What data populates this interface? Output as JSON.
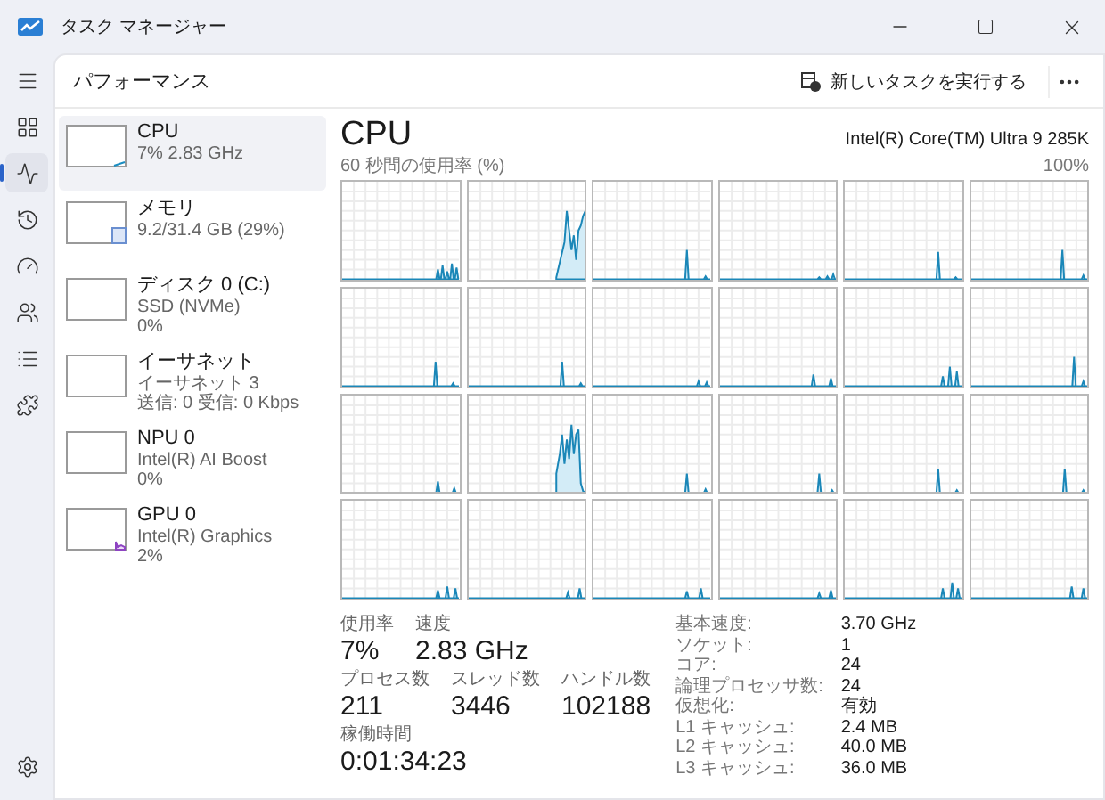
{
  "window": {
    "title": "タスク マネージャー"
  },
  "nav_items": [
    {
      "kind": "menu",
      "selected": false
    },
    {
      "kind": "processes",
      "selected": false
    },
    {
      "kind": "performance",
      "selected": true
    },
    {
      "kind": "history",
      "selected": false
    },
    {
      "kind": "startup",
      "selected": false
    },
    {
      "kind": "users",
      "selected": false
    },
    {
      "kind": "details",
      "selected": false
    },
    {
      "kind": "services",
      "selected": false
    }
  ],
  "header": {
    "title": "パフォーマンス",
    "run_task_button": "新しいタスクを実行する"
  },
  "devices": [
    {
      "kind": "cpu",
      "name": "CPU",
      "lines": [
        "7% 2.83 GHz"
      ],
      "selected": true
    },
    {
      "kind": "memory",
      "name": "メモリ",
      "lines": [
        "9.2/31.4 GB (29%)"
      ],
      "selected": false
    },
    {
      "kind": "disk",
      "name": "ディスク 0 (C:)",
      "lines": [
        "SSD (NVMe)",
        "0%"
      ],
      "selected": false
    },
    {
      "kind": "network",
      "name": "イーサネット",
      "lines": [
        "イーサネット 3",
        "送信: 0 受信: 0 Kbps"
      ],
      "selected": false
    },
    {
      "kind": "npu",
      "name": "NPU 0",
      "lines": [
        "Intel(R) AI Boost",
        "0%"
      ],
      "selected": false
    },
    {
      "kind": "gpu",
      "name": "GPU 0",
      "lines": [
        "Intel(R) Graphics",
        "2%"
      ],
      "selected": false
    }
  ],
  "detail": {
    "title": "CPU",
    "model": "Intel(R) Core(TM) Ultra 9 285K",
    "graph_caption": "60 秒間の使用率 (%)",
    "graph_max": "100%",
    "stats": [
      [
        {
          "label": "使用率",
          "value": "7%"
        },
        {
          "label": "速度",
          "value": "2.83 GHz"
        }
      ],
      [
        {
          "label": "プロセス数",
          "value": "211"
        },
        {
          "label": "スレッド数",
          "value": "3446"
        },
        {
          "label": "ハンドル数",
          "value": "102188"
        }
      ],
      [
        {
          "label": "稼働時間",
          "value": "0:01:34:23"
        }
      ]
    ],
    "specs": [
      {
        "label": "基本速度:",
        "value": "3.70 GHz"
      },
      {
        "label": "ソケット:",
        "value": "1"
      },
      {
        "label": "コア:",
        "value": "24"
      },
      {
        "label": "論理プロセッサ数:",
        "value": "24"
      },
      {
        "label": "仮想化:",
        "value": "有効"
      },
      {
        "label": "L1 キャッシュ:",
        "value": "2.4 MB"
      },
      {
        "label": "L2 キャッシュ:",
        "value": "40.0 MB"
      },
      {
        "label": "L3 キャッシュ:",
        "value": "36.0 MB"
      }
    ]
  }
}
